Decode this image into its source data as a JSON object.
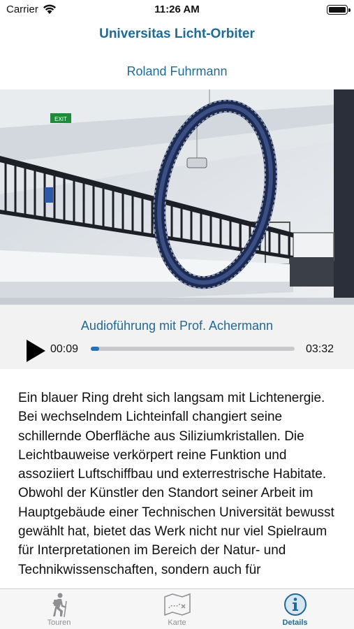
{
  "status_bar": {
    "carrier": "Carrier",
    "time": "11:26 AM"
  },
  "header": {
    "title": "Universitas Licht-Orbiter",
    "artist": "Roland Fuhrmann"
  },
  "artwork": {
    "exit_sign": "EXIT"
  },
  "audio": {
    "title": "Audioführung mit Prof. Achermann",
    "current_time": "00:09",
    "duration": "03:32",
    "progress": 0.042
  },
  "description": "Ein blauer Ring dreht sich langsam mit Lichtenergie. Bei wechselndem Lichteinfall changiert seine schillernde Oberfläche aus Siliziumkristallen. Die Leichtbauweise verkörpert reine Funktion und assoziiert Luftschiffbau und exterrestrische Habitate. Obwohl der Künstler den Standort seiner Arbeit im Hauptgebäude einer Technischen Universität bewusst gewählt hat, bietet das Werk nicht nur viel Spielraum für Interpretationen im Bereich der Natur- und Technikwissenschaften, sondern auch für",
  "tabs": [
    {
      "label": "Touren",
      "icon": "hiker-icon",
      "active": false
    },
    {
      "label": "Karte",
      "icon": "map-icon",
      "active": false
    },
    {
      "label": "Details",
      "icon": "info-icon",
      "active": true
    }
  ],
  "colors": {
    "accent": "#1f6a96",
    "progress": "#2a6fb2",
    "audio_bg": "#f2f2f3"
  }
}
